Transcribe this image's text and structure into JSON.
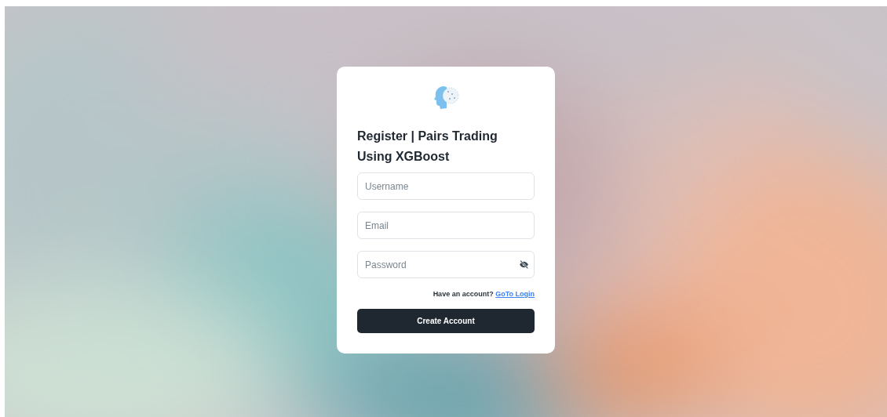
{
  "title": "Register | Pairs Trading Using XGBoost",
  "fields": [
    {
      "kind": "text",
      "placeholder": "Username"
    },
    {
      "kind": "text",
      "placeholder": "Email"
    },
    {
      "kind": "password",
      "placeholder": "Password"
    }
  ],
  "account_prompt": {
    "text": "Have an account?",
    "link": "GoTo Login"
  },
  "submit_button": "Create Account"
}
